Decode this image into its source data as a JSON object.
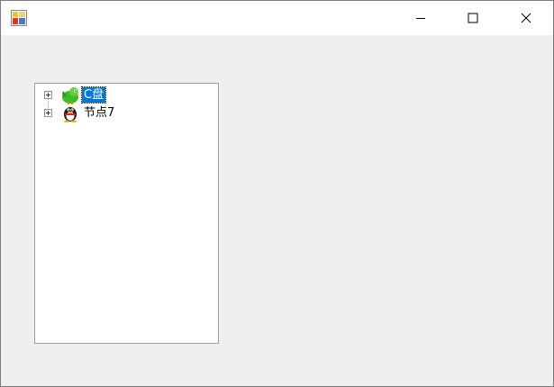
{
  "window": {
    "title": "",
    "controls": {
      "minimize_icon": "minimize-icon",
      "maximize_icon": "maximize-icon",
      "close_icon": "close-icon"
    }
  },
  "tree": {
    "nodes": [
      {
        "label": "C盘",
        "icon": "green-bird-icon",
        "expander": "plus",
        "selected": true
      },
      {
        "label": "节点7",
        "icon": "qq-penguin-icon",
        "expander": "plus",
        "selected": false
      }
    ]
  },
  "colors": {
    "selection": "#0078d7",
    "client_bg": "#efefef",
    "titlebar_bg": "#ffffff"
  }
}
